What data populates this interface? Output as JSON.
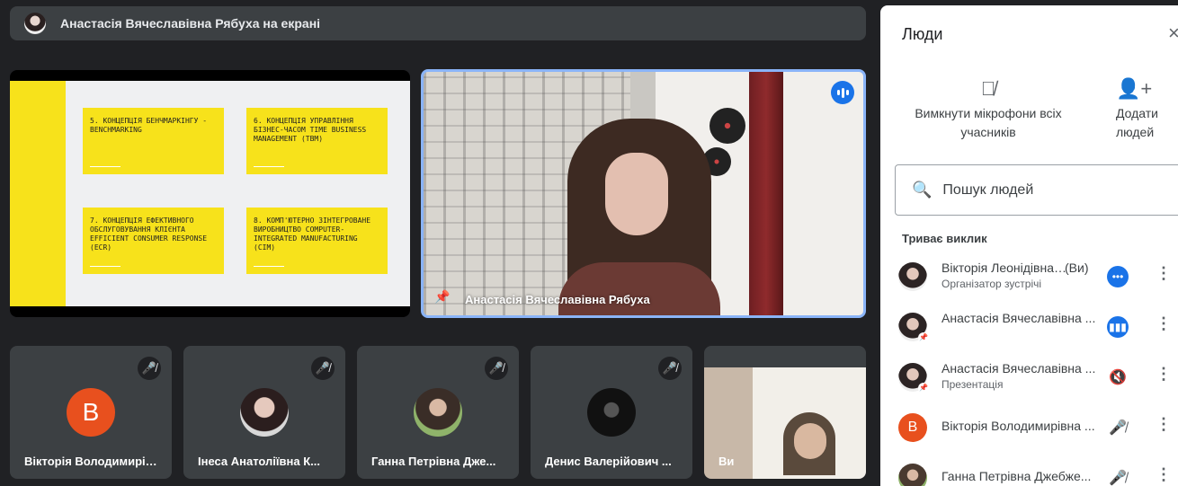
{
  "banner": {
    "text": "Анастасія Вячеславівна Рябуха на екрані"
  },
  "slide": {
    "cards": [
      "5. Концепція бенчмаркінгу - Benchmarking",
      "6. Концепція управління бізнес-часом Time Business Management (TBM)",
      "7. Концепція ефективного обслуговування клієнта Efficient Consumer Response (ECR)",
      "8. Комп'ютерно зінтегроване виробництво Computer-integrated manufacturing (CIM)"
    ]
  },
  "speaker": {
    "name": "Анастасія Вячеславівна Рябуха",
    "pin_icon": "pin-icon",
    "speaking_icon": "speaking-icon"
  },
  "tiles": [
    {
      "name": "Вікторія Володимирівна ...",
      "initial": "B",
      "color": "#e8501e"
    },
    {
      "name": "Інеса Анатоліївна К...",
      "initial": ""
    },
    {
      "name": "Ганна Петрівна Дже...",
      "initial": ""
    },
    {
      "name": "Денис Валерійович ...",
      "initial": ""
    },
    {
      "name": "Ви",
      "initial": ""
    }
  ],
  "panel": {
    "title": "Люди",
    "close": "×",
    "actions": [
      {
        "label": "Вимкнути мікрофони всіх учасників",
        "icon": "mic-off-icon"
      },
      {
        "label": "Додати людей",
        "icon": "add-person-icon"
      }
    ],
    "search_placeholder": "Пошук людей",
    "section": "Триває виклик",
    "people": [
      {
        "name": "Вікторія Леонідівна ...",
        "suffix": "(Ви)",
        "sub": "Організатор зустрічі",
        "status": "more-horiz-icon"
      },
      {
        "name": "Анастасія Вячеславівна ...",
        "sub": "",
        "status": "speaking-icon"
      },
      {
        "name": "Анастасія Вячеславівна ...",
        "sub": "Презентація",
        "status": "volume-off-icon"
      },
      {
        "name": "Вікторія Володимирівна ...",
        "sub": "",
        "initial": "B",
        "status": "mic-off-icon"
      },
      {
        "name": "Ганна Петрівна Джебже...",
        "sub": "",
        "status": "mic-off-icon"
      }
    ]
  }
}
